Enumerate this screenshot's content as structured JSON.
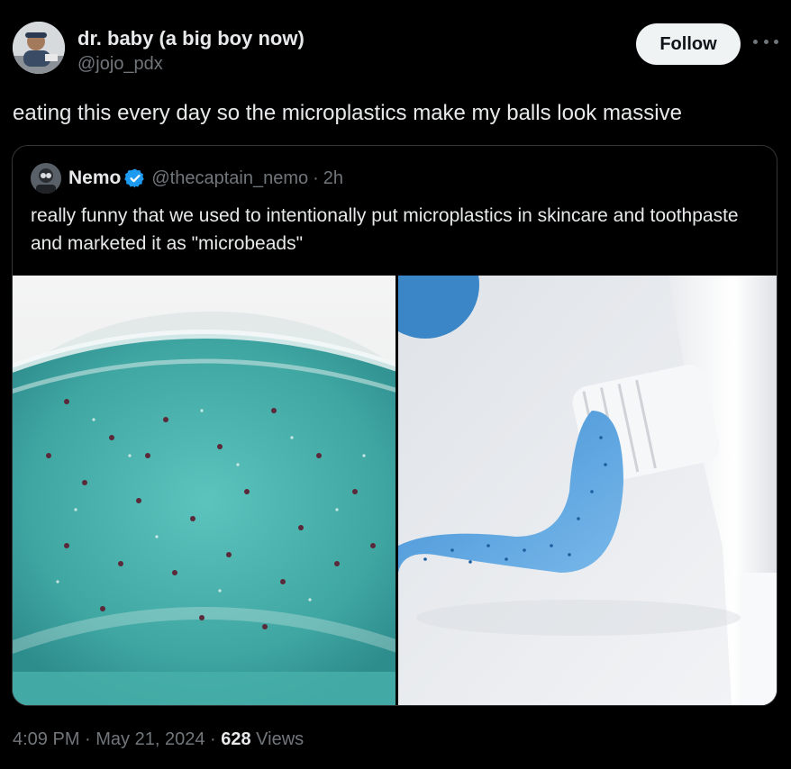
{
  "tweet": {
    "author": {
      "display_name": "dr. baby (a big boy now)",
      "handle": "@jojo_pdx"
    },
    "follow_label": "Follow",
    "more_icon": "more-icon",
    "text": "eating this every day so the microplastics make my balls look massive",
    "footer": {
      "time": "4:09 PM",
      "sep1": " · ",
      "date": "May 21, 2024",
      "sep2": " · ",
      "views": "628",
      "views_label": " Views"
    }
  },
  "quote": {
    "author": {
      "display_name": "Nemo",
      "verified_icon": "verified-badge-icon",
      "handle": "@thecaptain_nemo",
      "dot": "·",
      "time": "2h"
    },
    "text": "really funny that we used to intentionally put microplastics in skincare and toothpaste and marketed it as \"microbeads\"",
    "colors": {
      "verified": "#1d9bf0",
      "gel": "#4fb5b0",
      "toothpaste": "#5aa7e0"
    }
  }
}
